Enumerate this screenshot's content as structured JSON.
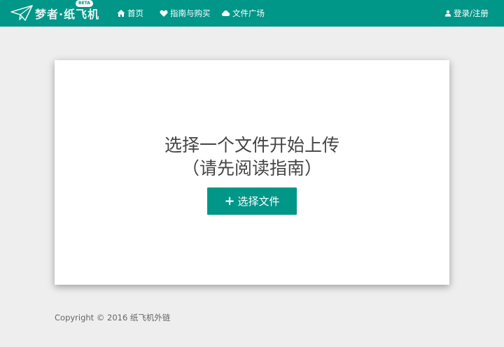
{
  "navbar": {
    "brand_text": "梦者·纸飞机",
    "beta_badge": "BETA",
    "links": [
      {
        "label": "首页",
        "icon": "home-icon"
      },
      {
        "label": "指南与购买",
        "icon": "heart-icon"
      },
      {
        "label": "文件广场",
        "icon": "cloud-icon"
      }
    ],
    "login": {
      "label": "登录/注册",
      "icon": "user-icon"
    }
  },
  "upload": {
    "title": "选择一个文件开始上传",
    "subtitle": "（请先阅读指南）",
    "button_icon": "+",
    "button_label": "选择文件"
  },
  "footer": {
    "text": "Copyright © 2016 纸飞机外链"
  },
  "colors": {
    "primary": "#009688",
    "background": "#eeeeee",
    "card": "#ffffff",
    "text": "#444444"
  }
}
